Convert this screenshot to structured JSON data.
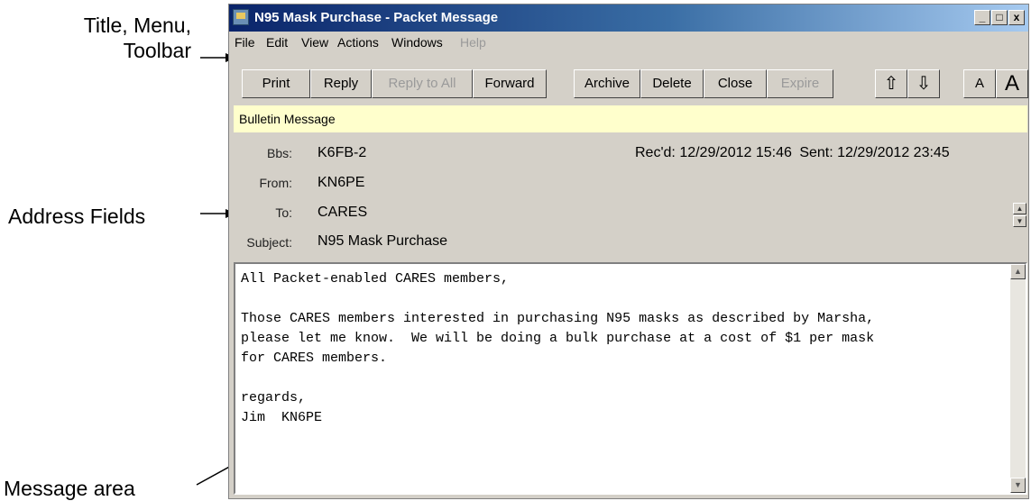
{
  "annotations": {
    "title_menu_toolbar_line1": "Title, Menu,",
    "title_menu_toolbar_line2": "Toolbar",
    "address_fields": "Address Fields",
    "message_area": "Message area"
  },
  "window": {
    "title": "N95 Mask Purchase - Packet Message",
    "controls": {
      "minimize": "_",
      "maximize": "□",
      "close": "x"
    }
  },
  "menu": {
    "file": "File",
    "edit": "Edit",
    "view": "View",
    "actions": "Actions",
    "windows": "Windows",
    "help": "Help"
  },
  "toolbar": {
    "print": "Print",
    "reply": "Reply",
    "reply_all": "Reply to All",
    "forward": "Forward",
    "archive": "Archive",
    "delete": "Delete",
    "close": "Close",
    "expire": "Expire",
    "up": "⇧",
    "down": "⇩",
    "font_small": "A",
    "font_large": "A"
  },
  "message_type": "Bulletin Message",
  "fields": {
    "bbs_label": "Bbs:",
    "bbs_value": "K6FB-2",
    "from_label": "From:",
    "from_value": "KN6PE",
    "to_label": "To:",
    "to_value": "CARES",
    "subject_label": "Subject:",
    "subject_value": "N95 Mask Purchase",
    "recd_label": "Rec'd:",
    "recd_value": "12/29/2012 15:46",
    "sent_label": "Sent:",
    "sent_value": "12/29/2012 23:45"
  },
  "body_text": "All Packet-enabled CARES members,\n\nThose CARES members interested in purchasing N95 masks as described by Marsha,\nplease let me know.  We will be doing a bulk purchase at a cost of $1 per mask\nfor CARES members.\n\nregards,\nJim  KN6PE"
}
